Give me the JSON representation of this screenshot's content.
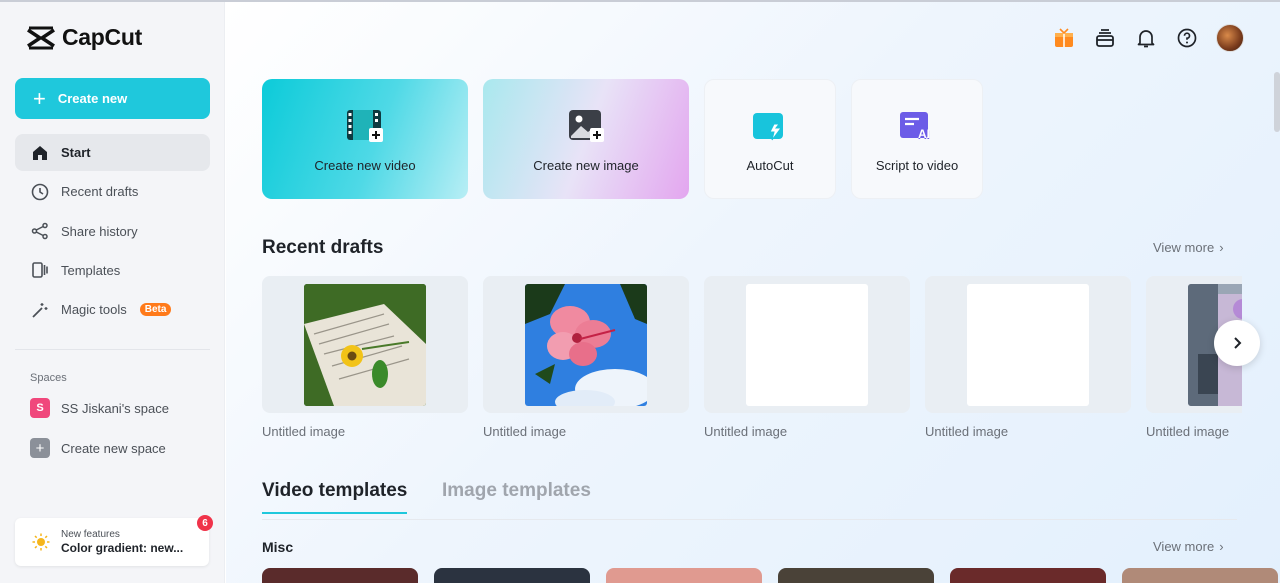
{
  "app": {
    "name": "CapCut"
  },
  "sidebar": {
    "create_label": "Create new",
    "nav": [
      {
        "label": "Start",
        "icon": "home-icon"
      },
      {
        "label": "Recent drafts",
        "icon": "clock-icon"
      },
      {
        "label": "Share history",
        "icon": "share-icon"
      },
      {
        "label": "Templates",
        "icon": "templates-icon"
      },
      {
        "label": "Magic tools",
        "icon": "magic-wand-icon",
        "badge": "Beta"
      }
    ],
    "spaces_label": "Spaces",
    "spaces": [
      {
        "label": "SS Jiskani's space",
        "initial": "S"
      },
      {
        "label": "Create new space"
      }
    ],
    "features": {
      "title": "New features",
      "subtitle": "Color gradient: new...",
      "count": "6"
    }
  },
  "quick_actions": [
    {
      "label": "Create new video",
      "icon": "film-plus-icon"
    },
    {
      "label": "Create new image",
      "icon": "image-plus-icon"
    },
    {
      "label": "AutoCut",
      "icon": "autocut-icon"
    },
    {
      "label": "Script to video",
      "icon": "script-ai-icon"
    }
  ],
  "recent_drafts": {
    "title": "Recent drafts",
    "view_more": "View more",
    "items": [
      {
        "caption": "Untitled image"
      },
      {
        "caption": "Untitled image"
      },
      {
        "caption": "Untitled image"
      },
      {
        "caption": "Untitled image"
      },
      {
        "caption": "Untitled image"
      }
    ]
  },
  "templates": {
    "tabs": [
      "Video templates",
      "Image templates"
    ],
    "category": "Misc",
    "view_more": "View more"
  },
  "colors": {
    "accent": "#1fc8dc",
    "beta": "#ff7a1a",
    "badge": "#f0334a"
  }
}
